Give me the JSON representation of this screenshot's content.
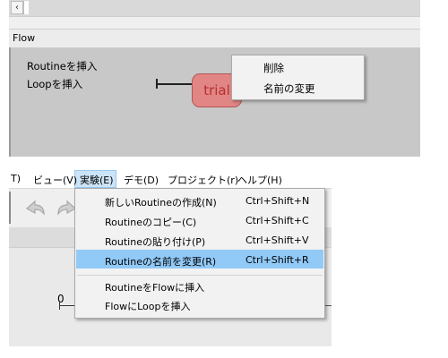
{
  "flow_panel": {
    "label": "Flow",
    "insert_routine": "Routineを挿入",
    "insert_loop": "Loopを挿入",
    "routine_name": "trial",
    "context_menu": {
      "delete": "削除",
      "rename": "名前の変更"
    }
  },
  "menubar": {
    "items": [
      {
        "label": "T)"
      },
      {
        "label": "ビュー(V)"
      },
      {
        "label": "実験(E)"
      },
      {
        "label": "デモ(D)"
      },
      {
        "label": "プロジェクト(r)"
      },
      {
        "label": "ヘルプ(H)"
      }
    ]
  },
  "experiment_menu": {
    "items": [
      {
        "label": "新しいRoutineの作成(N)",
        "shortcut": "Ctrl+Shift+N"
      },
      {
        "label": "Routineのコピー(C)",
        "shortcut": "Ctrl+Shift+C"
      },
      {
        "label": "Routineの貼り付け(P)",
        "shortcut": "Ctrl+Shift+V"
      },
      {
        "label": "Routineの名前を変更(R)",
        "shortcut": "Ctrl+Shift+R"
      },
      {
        "label": "RoutineをFlowに挿入",
        "shortcut": ""
      },
      {
        "label": "FlowにLoopを挿入",
        "shortcut": ""
      }
    ],
    "highlighted_index": 3
  },
  "timeline": {
    "zero_label": "0"
  },
  "icons": {
    "scroll_left": "scroll-left-arrow-icon",
    "undo": "undo-icon",
    "redo": "redo-icon"
  },
  "colors": {
    "highlight": "#91c9f7",
    "routine_fill": "#e28585",
    "routine_text": "#b53030"
  }
}
